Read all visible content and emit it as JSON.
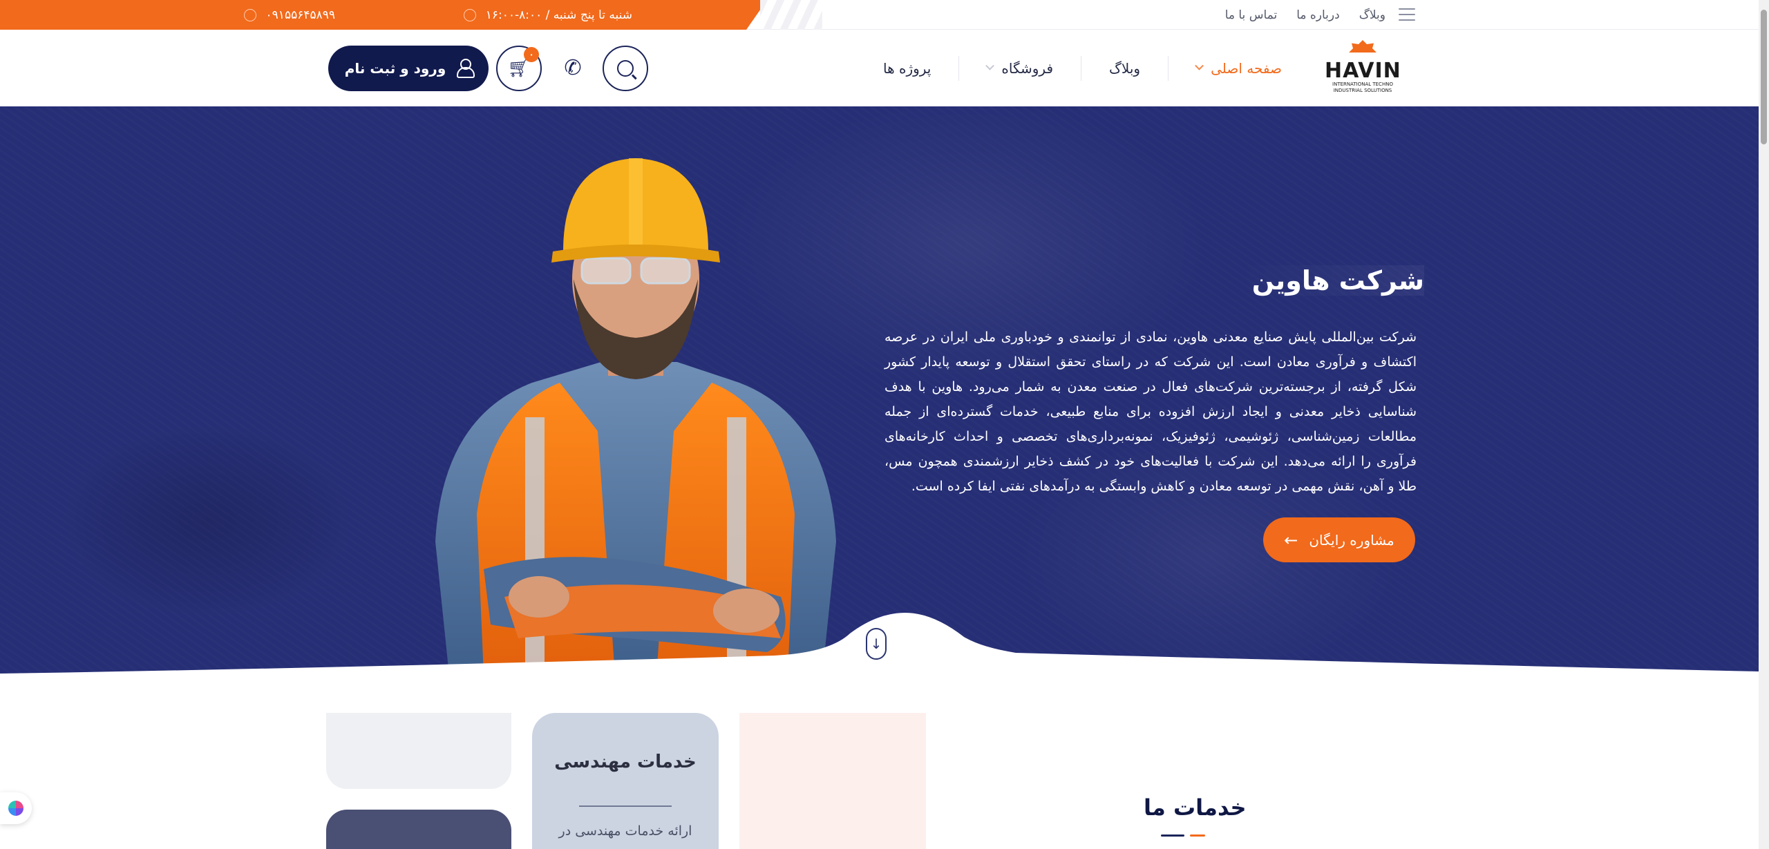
{
  "topbar": {
    "hours": "شنبه تا پنج شنبه / ۸:۰۰-۱۶:۰۰",
    "phone": "۰۹۱۵۵۶۴۵۸۹۹",
    "links": [
      "وبلاگ",
      "درباره ما",
      "تماس با ما"
    ]
  },
  "header": {
    "logo_text": "HAVIN",
    "logo_tagline": "INTERNATIONAL TECHNO INDUSTRIAL SOLUTIONS",
    "nav": [
      "صفحه اصلی",
      "وبلاگ",
      "فروشگاه",
      "پروژه ها"
    ],
    "cart_count": "۰",
    "login_label": "ورود و ثبت نام"
  },
  "hero": {
    "title": "شرکت هاوین",
    "text": "شرکت بین‌المللی پایش صنایع معدنی هاوین، نمادی از توانمندی و خودباوری ملی ایران در عرصه اکتشاف و فرآوری معادن است. این شرکت که در راستای تحقق استقلال و توسعه پایدار کشور شکل گرفته، از برجسته‌ترین شرکت‌های فعال در صنعت معدن به شمار می‌رود. هاوین با هدف شناسایی ذخایر معدنی و ایجاد ارزش افزوده برای منابع طبیعی، خدمات گسترده‌ای از جمله مطالعات زمین‌شناسی، ژئوشیمی، ژئوفیزیک، نمونه‌برداری‌های تخصصی و احداث کارخانه‌های فرآوری را ارائه می‌دهد. این شرکت با فعالیت‌های خود در کشف ذخایر ارزشمندی همچون مس، طلا و آهن، نقش مهمی در توسعه معادن و کاهش وابستگی به درآمدهای نفتی ایفا کرده است.",
    "cta_label": "مشاوره رایگان"
  },
  "services": {
    "title": "خدمات ما",
    "card_title": "خدمات مهندسی",
    "card_desc": "ارائه خدمات مهندسی در"
  },
  "colors": {
    "accent": "#f26a1b",
    "navy": "#111a4d",
    "hero_bg": "#262e75"
  }
}
